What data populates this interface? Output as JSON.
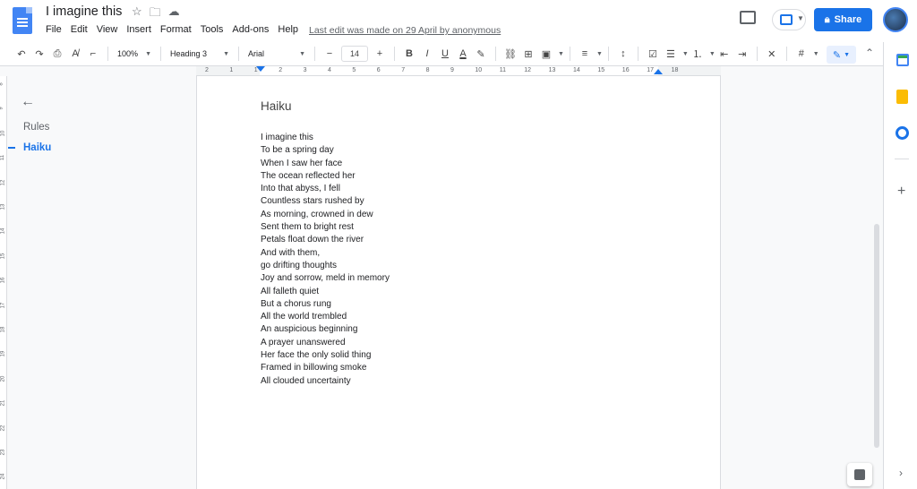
{
  "app": {
    "doc_title": "I imagine this",
    "last_edit": "Last edit was made on 29 April by anonymous",
    "share_label": "Share"
  },
  "menu": [
    "File",
    "Edit",
    "View",
    "Insert",
    "Format",
    "Tools",
    "Add-ons",
    "Help"
  ],
  "toolbar": {
    "zoom": "100%",
    "style": "Heading 3",
    "font": "Arial",
    "font_size": "14",
    "minus": "−",
    "plus": "+",
    "bold": "B",
    "italic": "I",
    "underline": "U",
    "text_color": "A"
  },
  "ruler": {
    "numbers": [
      "2",
      "1",
      "1",
      "2",
      "3",
      "4",
      "5",
      "6",
      "7",
      "8",
      "9",
      "10",
      "11",
      "12",
      "13",
      "14",
      "15",
      "16",
      "17",
      "18"
    ]
  },
  "vruler": {
    "numbers": [
      "8",
      "9",
      "10",
      "11",
      "12",
      "13",
      "14",
      "15",
      "16",
      "17",
      "18",
      "19",
      "20",
      "21",
      "22",
      "23",
      "24"
    ]
  },
  "outline": {
    "items": [
      {
        "label": "Rules",
        "active": false
      },
      {
        "label": "Haiku",
        "active": true
      }
    ]
  },
  "document": {
    "heading": "Haiku",
    "lines": [
      "I imagine this",
      "To be a spring day",
      "When I saw her face",
      "The ocean reflected her",
      "Into that abyss, I fell",
      "Countless stars rushed by",
      "As morning, crowned in dew",
      "Sent them to bright rest",
      "Petals float down the river",
      "And with them,",
      "go drifting thoughts",
      "Joy and sorrow, meld in memory",
      "All falleth quiet",
      "But a chorus rung",
      "All the world trembled",
      "An auspicious beginning",
      "A prayer unanswered",
      "Her face the only solid thing",
      "Framed in billowing smoke",
      "All clouded uncertainty"
    ]
  },
  "colors": {
    "accent": "#1a73e8",
    "docs_blue": "#4285f4",
    "keep_yellow": "#fbbc04",
    "calendar_green": "#34a853"
  }
}
